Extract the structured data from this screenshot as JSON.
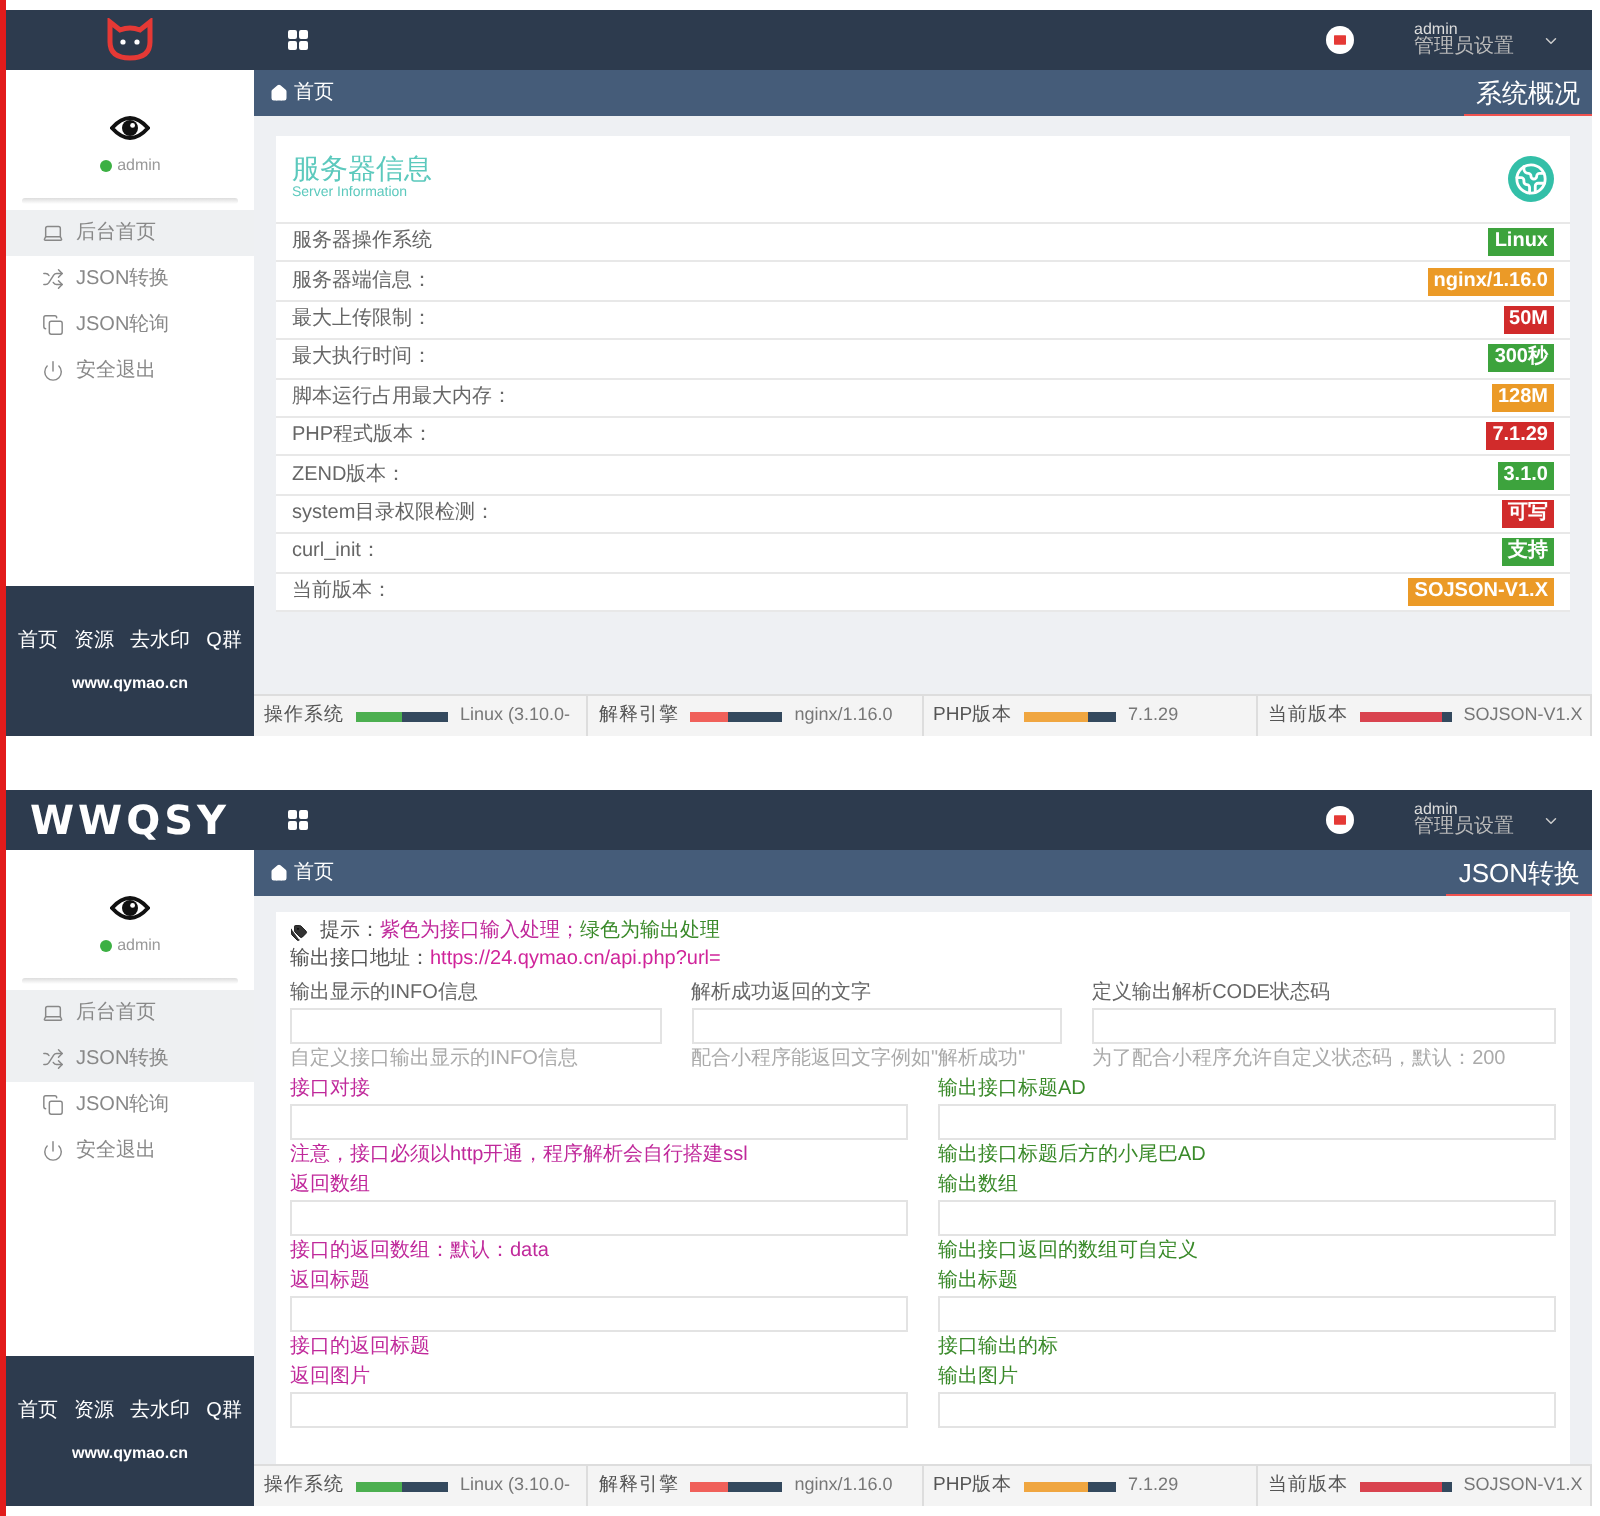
{
  "screens": [
    {
      "logo": {
        "kind": "cat"
      },
      "user": {
        "name": "admin"
      },
      "sidebar": {
        "items": [
          {
            "label": "后台首页",
            "selected": true
          },
          {
            "label": "JSON转换",
            "selected": false
          },
          {
            "label": "JSON轮询",
            "selected": false
          },
          {
            "label": "安全退出",
            "selected": false
          }
        ],
        "footer_links": [
          "首页",
          "资源",
          "去水印",
          "Q群"
        ],
        "site": "www.qymao.cn"
      },
      "header": {
        "user_name": "admin",
        "user_role": "管理员设置"
      },
      "breadcrumb": "首页",
      "page_title": "系统概况",
      "content": {
        "kind": "server_info",
        "title": "服务器信息",
        "subtitle": "Server Information",
        "rows": [
          {
            "label": "服务器操作系统",
            "value": "Linux",
            "color": "#3da33d"
          },
          {
            "label": "服务器端信息：",
            "value": "nginx/1.16.0",
            "color": "#eb9a27"
          },
          {
            "label": "最大上传限制：",
            "value": "50M",
            "color": "#d12b2b"
          },
          {
            "label": "最大执行时间：",
            "value": "300秒",
            "color": "#3da33d"
          },
          {
            "label": "脚本运行占用最大内存：",
            "value": "128M",
            "color": "#eb9a27"
          },
          {
            "label": "PHP程式版本：",
            "value": "7.1.29",
            "color": "#d12b2b"
          },
          {
            "label": "ZEND版本：",
            "value": "3.1.0",
            "color": "#3da33d"
          },
          {
            "label": "system目录权限检测：",
            "value": "可写",
            "color": "#d12b2b"
          },
          {
            "label": "curl_init：",
            "value": "支持",
            "color": "#3da33d"
          },
          {
            "label": "当前版本：",
            "value": "SOJSON-V1.X",
            "color": "#eb9a27"
          }
        ]
      },
      "status_bar": [
        {
          "label": "操作系统",
          "value": "Linux (3.10.0-",
          "color": "#4caf50",
          "level": 0.5
        },
        {
          "label": "解释引擎",
          "value": "nginx/1.16.0",
          "color": "#f0605a",
          "level": 0.4
        },
        {
          "label": "PHP版本",
          "value": "7.1.29",
          "color": "#f0a640",
          "level": 0.7
        },
        {
          "label": "当前版本",
          "value": "SOJSON-V1.X",
          "color": "#d9434f",
          "level": 0.9
        }
      ]
    },
    {
      "logo": {
        "kind": "text",
        "text": "WWQSY"
      },
      "user": {
        "name": "admin"
      },
      "sidebar": {
        "items": [
          {
            "label": "后台首页",
            "selected": true
          },
          {
            "label": "JSON转换",
            "selected": true
          },
          {
            "label": "JSON轮询",
            "selected": false
          },
          {
            "label": "安全退出",
            "selected": false
          }
        ],
        "footer_links": [
          "首页",
          "资源",
          "去水印",
          "Q群"
        ],
        "site": "www.qymao.cn"
      },
      "header": {
        "user_name": "admin",
        "user_role": "管理员设置"
      },
      "breadcrumb": "首页",
      "page_title": "JSON转换",
      "content": {
        "kind": "json_form",
        "hint": [
          {
            "text": "提示：",
            "color": "#555555"
          },
          {
            "text": "紫色为接口输入处理；",
            "color": "#c0299b"
          },
          {
            "text": "绿色为输出处理",
            "color": "#3a8a2a"
          }
        ],
        "api_address": {
          "label": "输出接口地址：",
          "link": "https://24.qymao.cn/api.php?url="
        },
        "top_fields": [
          {
            "label": "输出显示的INFO信息",
            "help": "自定义接口输出显示的INFO信息"
          },
          {
            "label": "解析成功返回的文字",
            "help": "配合小程序能返回文字例如\"解析成功\""
          },
          {
            "label": "定义输出解析CODE状态码",
            "help": "为了配合小程序允许自定义状态码，默认：200"
          }
        ],
        "field_rows": [
          [
            {
              "label": "接口对接",
              "help": "注意，接口必须以http开通，程序解析会自行搭建ssl",
              "color": "#c0299b"
            },
            {
              "label": "输出接口标题AD",
              "help": "输出接口标题后方的小尾巴AD",
              "color": "#3a8a2a"
            }
          ],
          [
            {
              "label": "返回数组",
              "help": "接口的返回数组：默认：data",
              "color": "#c0299b"
            },
            {
              "label": "输出数组",
              "help": "输出接口返回的数组可自定义",
              "color": "#3a8a2a"
            }
          ],
          [
            {
              "label": "返回标题",
              "help": "接口的返回标题",
              "color": "#c0299b"
            },
            {
              "label": "输出标题",
              "help": "接口输出的标",
              "color": "#3a8a2a"
            }
          ],
          [
            {
              "label": "返回图片",
              "color": "#c0299b"
            },
            {
              "label": "输出图片",
              "color": "#3a8a2a"
            }
          ]
        ]
      },
      "status_bar": [
        {
          "label": "操作系统",
          "value": "Linux (3.10.0-",
          "color": "#4caf50",
          "level": 0.5
        },
        {
          "label": "解释引擎",
          "value": "nginx/1.16.0",
          "color": "#f0605a",
          "level": 0.4
        },
        {
          "label": "PHP版本",
          "value": "7.1.29",
          "color": "#f0a640",
          "level": 0.7
        },
        {
          "label": "当前版本",
          "value": "SOJSON-V1.X",
          "color": "#d9434f",
          "level": 0.9
        }
      ]
    }
  ]
}
